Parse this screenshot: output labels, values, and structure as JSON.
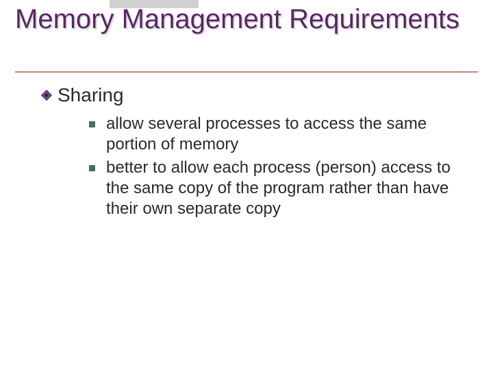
{
  "title": "Memory Management Requirements",
  "section": {
    "heading": "Sharing",
    "bullets": [
      "allow several processes to access the same portion of memory",
      "better to allow each process (person) access to the same copy of the program rather than have their own separate copy"
    ]
  }
}
